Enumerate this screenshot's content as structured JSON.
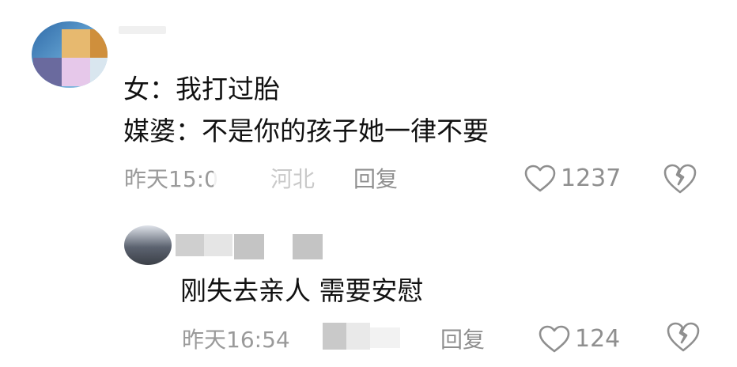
{
  "comments": [
    {
      "lines": [
        "女：我打过胎",
        "媒婆：不是你的孩子她一律不要"
      ],
      "time": "昨天15:0",
      "location": "河北",
      "reply_label": "回复",
      "likes": "1237"
    },
    {
      "lines": [
        "刚失去亲人 需要安慰"
      ],
      "time": "昨天16:54",
      "reply_label": "回复",
      "likes": "124"
    }
  ],
  "icons": {
    "like": "heart-outline-icon",
    "dislike": "broken-heart-icon"
  },
  "colors": {
    "meta_text": "#9a9a9a",
    "icon_stroke": "#8f8f8f",
    "body_text": "#111111"
  }
}
